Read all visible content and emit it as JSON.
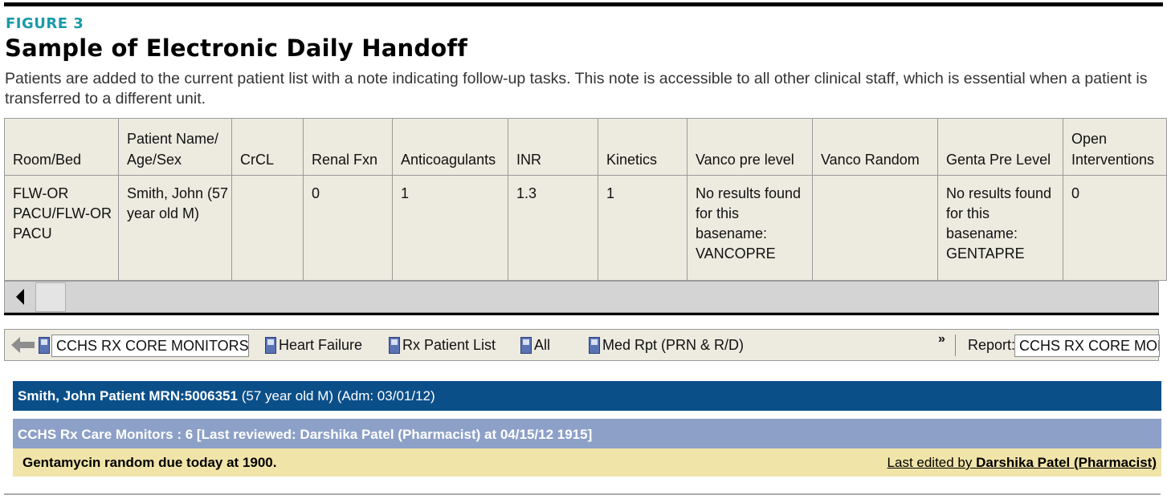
{
  "figure": {
    "label": "FIGURE 3",
    "title": "Sample of Electronic Daily Handoff",
    "caption": "Patients are added to the current patient list with a note indicating follow-up tasks. This note is accessible to all other clinical staff, which is essential when a patient is transferred to a different unit."
  },
  "table": {
    "headers": [
      "Room/Bed",
      "Patient Name/ Age/Sex",
      "CrCL",
      "Renal Fxn",
      "Anticoagulants",
      "INR",
      "Kinetics",
      "Vanco pre level",
      "Vanco Random",
      "Genta Pre Level",
      "Open Interventions"
    ],
    "row": {
      "room_bed": "FLW-OR PACU/FLW-OR PACU",
      "patient": "Smith, John (57 year old M)",
      "crcl": "",
      "renal_fxn": "0",
      "anticoagulants": "1",
      "inr": "1.3",
      "kinetics": "1",
      "vanco_pre_level": "No results found for this basename: VANCOPRE",
      "vanco_random": "",
      "genta_pre_level": "No results found for this basename: GENTAPRE",
      "open_interventions": "0"
    }
  },
  "toolbar": {
    "current_list": "CCHS RX CORE MONITORS",
    "lists": [
      "Heart Failure",
      "Rx Patient List",
      "All",
      "Med Rpt (PRN & R/D)"
    ],
    "overflow_label": "»",
    "report_label": "Report:",
    "report_value": "CCHS RX CORE MONITO"
  },
  "patient_banner": {
    "name_mrn": "Smith, John Patient MRN:5006351",
    "details": "(57 year old M) (Adm: 03/01/12)"
  },
  "monitors": {
    "header": "CCHS Rx Care Monitors : 6 [Last reviewed: Darshika Patel (Pharmacist) at 04/15/12 1915]",
    "note": "Gentamycin random due today at 1900.",
    "edited_prefix": "Last edited by ",
    "edited_by": "Darshika Patel (Pharmacist)"
  },
  "colors": {
    "figure_label": "#1a9aa8",
    "table_bg": "#edeae0",
    "patient_banner": "#0b4f89",
    "monitor_header": "#8da0c7",
    "note_bg": "#f1e4a8"
  },
  "icons": {
    "scroll_left": "left-triangle-icon",
    "back": "back-arrow-icon",
    "list": "list-document-icon"
  }
}
